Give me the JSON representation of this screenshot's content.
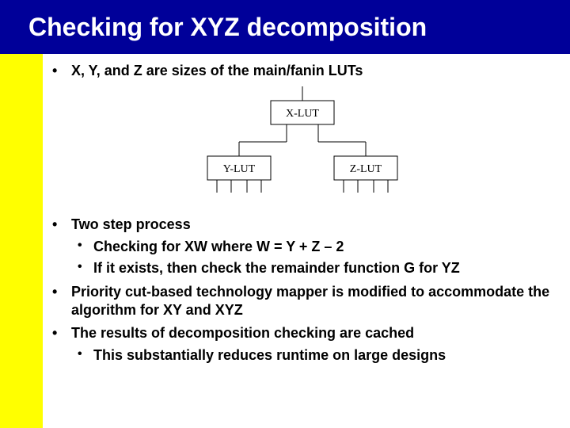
{
  "title": "Checking for XYZ decomposition",
  "bullets": {
    "b1": "X, Y, and Z are sizes of the main/fanin LUTs",
    "b2": "Two step process",
    "b2a": "Checking for XW where W = Y + Z – 2",
    "b2b": "If it exists, then check the remainder function G for YZ",
    "b3": "Priority cut-based technology mapper is modified to accommodate the algorithm for XY and XYZ",
    "b4": "The results of decomposition checking are cached",
    "b4a": "This substantially reduces runtime on large designs"
  },
  "diagram": {
    "xlut": "X-LUT",
    "ylut": "Y-LUT",
    "zlut": "Z-LUT"
  }
}
